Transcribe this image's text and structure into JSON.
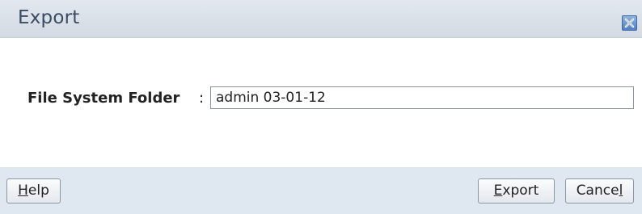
{
  "dialog": {
    "title": "Export"
  },
  "form": {
    "label": "File System Folder",
    "colon": ":",
    "value": "admin 03-01-12"
  },
  "buttons": {
    "help": {
      "pre": "",
      "mnemonic": "H",
      "post": "elp"
    },
    "export": {
      "pre": "",
      "mnemonic": "E",
      "post": "xport"
    },
    "cancel": {
      "pre": "Cance",
      "mnemonic": "l",
      "post": ""
    }
  },
  "icons": {
    "close": "close-icon"
  },
  "colors": {
    "title_text": "#3a4b63",
    "footer_bg": "#dfe7f0",
    "close_button": "#4f7fbe"
  }
}
